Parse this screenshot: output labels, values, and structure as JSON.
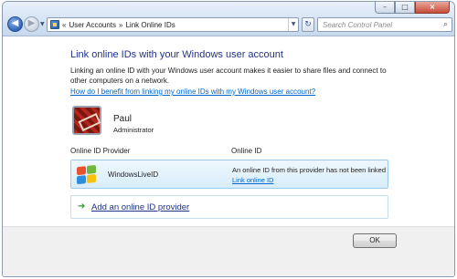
{
  "address_bar": {
    "crumbs": [
      "User Accounts",
      "Link Online IDs"
    ],
    "separator": "»",
    "chevron": "«"
  },
  "search": {
    "placeholder": "Search Control Panel"
  },
  "window_controls": {
    "minimize": "–",
    "maximize": "□",
    "close": "×"
  },
  "main": {
    "title": "Link online IDs with your Windows user account",
    "description": "Linking an online ID with your Windows user account makes it easier to share files and connect to other computers on a network.",
    "help_link": "How do I benefit from linking my online IDs with my Windows user account?"
  },
  "user": {
    "name": "Paul",
    "role": "Administrator"
  },
  "table": {
    "headers": [
      "Online ID Provider",
      "Online ID"
    ],
    "rows": [
      {
        "provider": "WindowsLiveID",
        "status": "An online ID from this provider has not been linked",
        "action": "Link online ID"
      }
    ]
  },
  "add_provider": {
    "label": "Add an online ID provider"
  },
  "footer": {
    "ok_label": "OK"
  },
  "icons": {
    "back": "back-arrow-icon",
    "forward": "forward-arrow-icon",
    "refresh": "refresh-icon",
    "search": "search-icon",
    "add": "green-arrow-icon",
    "provider": "windows-live-logo-icon"
  }
}
